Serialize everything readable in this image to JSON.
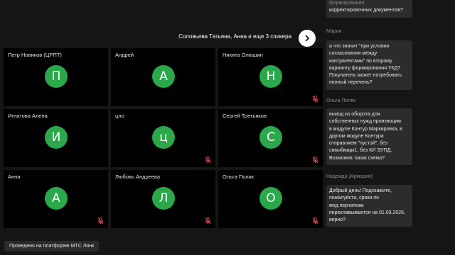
{
  "speakers_bar": {
    "label": "Соловьева Татьяна, Анна и еще 3 спикера"
  },
  "tiles": [
    {
      "name": "Петр Новиков (ЦРПТ)",
      "initial": "П",
      "mic_muted": false
    },
    {
      "name": "Андрей",
      "initial": "А",
      "mic_muted": false
    },
    {
      "name": "Никита Олюшин",
      "initial": "Н",
      "mic_muted": true
    },
    {
      "name": "Игнатова Алена",
      "initial": "И",
      "mic_muted": false
    },
    {
      "name": "цло",
      "initial": "ц",
      "mic_muted": true
    },
    {
      "name": "Сергей Третьяков",
      "initial": "С",
      "mic_muted": true
    },
    {
      "name": "Анна",
      "initial": "А",
      "mic_muted": true
    },
    {
      "name": "Любовь Андреева",
      "initial": "Л",
      "mic_muted": true
    },
    {
      "name": "Ольга Поляк",
      "initial": "О",
      "mic_muted": true
    }
  ],
  "chat": {
    "top_fragment": {
      "lines": [
        "формирования",
        "корректировочных документов?"
      ]
    },
    "messages": [
      {
        "author": "Мария",
        "lines": [
          "а что значит \"при условии",
          "согласования между",
          "контрагентами\" по второму",
          "варианту формирования УКД?",
          "Покупатель может потребовать",
          "полный перечень?"
        ]
      },
      {
        "author": "Ольга Поляк",
        "lines": [
          "вывод из оборота для",
          "собственных нужд произвоцим",
          "в модуле Контур.Маркировка, в",
          "другом модуле Контура",
          "отправляем \"пустой\", без",
          "сввыбмарк1, без КИ ЭУПД.",
          "Возможна такая схема?"
        ]
      },
      {
        "author": "Надежда (Армария)",
        "lines": [
          "Добрый день! Подскажите,",
          "пожалуйста, сроки по",
          "мед.перчаткам",
          "переклавываются на 01.03.2026,",
          "верно?"
        ]
      }
    ]
  },
  "footer": {
    "label": "Проведено на платформе МТС Линк"
  },
  "colors": {
    "background": "#151515",
    "tile_bg": "#000000",
    "avatar": "#2aa84a",
    "bubble": "#2c2c2c",
    "mic_muted": "#e04a4a"
  }
}
